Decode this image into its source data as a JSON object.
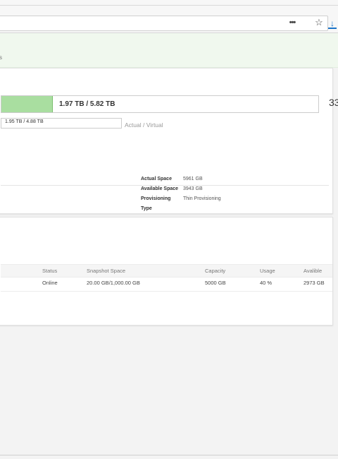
{
  "browser": {
    "menu_icon": "ellipsis-icon",
    "pocket_icon": "pocket-icon",
    "bookmark_icon": "star-icon",
    "download_icon": "download-icon"
  },
  "banner": {
    "fragment": "s"
  },
  "capacity": {
    "main_label": "1.97 TB / 5.82 TB",
    "main_fill_fraction": 0.16,
    "right_number": "33",
    "sub_label": "1.95 TB / 4.88 TB",
    "sub_caption": "Actual / Virtual"
  },
  "details": [
    {
      "key": "Actual Space",
      "value": "5961 GB"
    },
    {
      "key": "Available Space",
      "value": "3943 GB"
    },
    {
      "key": "Provisioning Type",
      "value": "Thin Provisioning"
    }
  ],
  "table": {
    "headers": [
      "Status",
      "Snapshot Space",
      "Capacity",
      "Usage",
      "Avalible"
    ],
    "rows": [
      [
        "Online",
        "20.00 GB/1,000.00 GB",
        "5000 GB",
        "40 %",
        "2973 GB"
      ]
    ]
  },
  "colors": {
    "fill_green": "#a9dea0",
    "banner_green": "#f0f8ee",
    "link_blue": "#1a73c8"
  }
}
